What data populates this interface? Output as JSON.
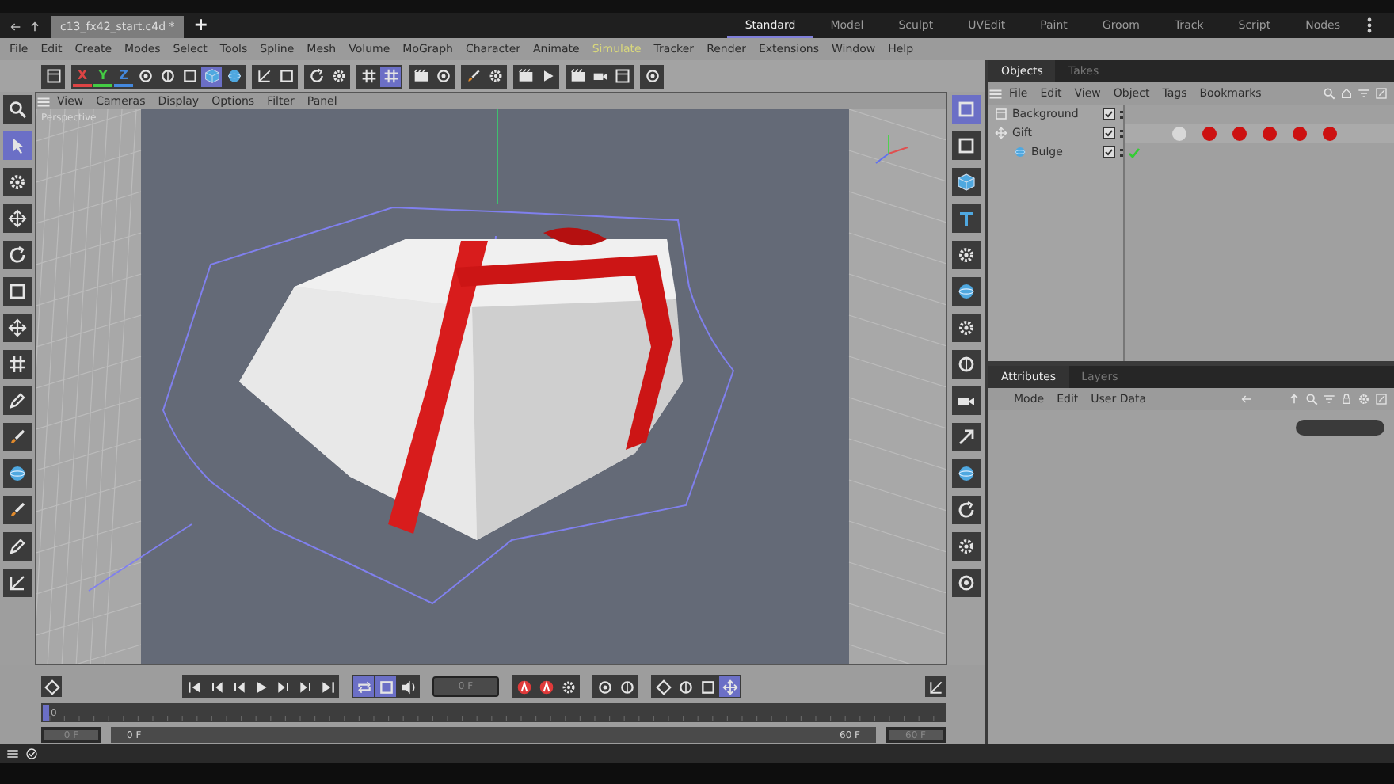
{
  "document_tab": {
    "title": "c13_fx42_start.c4d *"
  },
  "new_tab_button": "+",
  "layouts": [
    {
      "label": "Standard",
      "selected": true
    },
    {
      "label": "Model",
      "selected": false
    },
    {
      "label": "Sculpt",
      "selected": false
    },
    {
      "label": "UVEdit",
      "selected": false
    },
    {
      "label": "Paint",
      "selected": false
    },
    {
      "label": "Groom",
      "selected": false
    },
    {
      "label": "Track",
      "selected": false
    },
    {
      "label": "Script",
      "selected": false
    },
    {
      "label": "Nodes",
      "selected": false
    }
  ],
  "menu": [
    {
      "label": "File",
      "highlighted": false
    },
    {
      "label": "Edit",
      "highlighted": false
    },
    {
      "label": "Create",
      "highlighted": false
    },
    {
      "label": "Modes",
      "highlighted": false
    },
    {
      "label": "Select",
      "highlighted": false
    },
    {
      "label": "Tools",
      "highlighted": false
    },
    {
      "label": "Spline",
      "highlighted": false
    },
    {
      "label": "Mesh",
      "highlighted": false
    },
    {
      "label": "Volume",
      "highlighted": false
    },
    {
      "label": "MoGraph",
      "highlighted": false
    },
    {
      "label": "Character",
      "highlighted": false
    },
    {
      "label": "Animate",
      "highlighted": false
    },
    {
      "label": "Simulate",
      "highlighted": true
    },
    {
      "label": "Tracker",
      "highlighted": false
    },
    {
      "label": "Render",
      "highlighted": false
    },
    {
      "label": "Extensions",
      "highlighted": false
    },
    {
      "label": "Window",
      "highlighted": false
    },
    {
      "label": "Help",
      "highlighted": false
    }
  ],
  "axis_toggles": [
    "X",
    "Y",
    "Z"
  ],
  "toolbar_groups": [
    {
      "tools": [
        {
          "selected": false
        }
      ]
    },
    {
      "tools": [
        {
          "selected": false
        },
        {
          "selected": false
        },
        {
          "selected": false
        },
        {
          "selected": true
        },
        {
          "selected": false
        }
      ]
    },
    {
      "tools": [
        {
          "selected": false
        },
        {
          "selected": false
        }
      ]
    },
    {
      "tools": [
        {
          "selected": false
        },
        {
          "selected": false
        }
      ]
    },
    {
      "tools": [
        {
          "selected": false
        },
        {
          "selected": true
        }
      ]
    },
    {
      "tools": [
        {
          "selected": false
        },
        {
          "selected": false
        }
      ]
    },
    {
      "tools": [
        {
          "selected": false
        },
        {
          "selected": false
        }
      ]
    },
    {
      "tools": [
        {
          "selected": false
        },
        {
          "selected": false
        }
      ]
    },
    {
      "tools": [
        {
          "selected": false
        },
        {
          "selected": false
        },
        {
          "selected": false
        }
      ]
    },
    {
      "tools": [
        {
          "selected": false
        }
      ]
    }
  ],
  "viewport": {
    "menu": [
      "View",
      "Cameras",
      "Display",
      "Options",
      "Filter",
      "Panel"
    ],
    "camera_label": "Perspective"
  },
  "left_tools": [
    {
      "selected": false
    },
    {
      "selected": true
    },
    {
      "selected": false
    },
    {
      "selected": false
    },
    {
      "selected": false
    },
    {
      "selected": false
    },
    {
      "selected": false
    },
    {
      "selected": false
    },
    {
      "selected": false
    },
    {
      "selected": false
    },
    {
      "selected": false
    },
    {
      "selected": false
    },
    {
      "selected": false
    },
    {
      "selected": false
    }
  ],
  "right_tools": [
    {
      "selected": true
    },
    {
      "selected": false
    },
    {
      "selected": false
    },
    {
      "selected": false
    },
    {
      "selected": false
    },
    {
      "selected": false
    },
    {
      "selected": false
    },
    {
      "selected": false
    },
    {
      "selected": false
    },
    {
      "selected": false
    },
    {
      "selected": false
    },
    {
      "selected": false
    },
    {
      "selected": false
    },
    {
      "selected": false
    }
  ],
  "objects_panel": {
    "tabs": [
      {
        "label": "Objects",
        "selected": true
      },
      {
        "label": "Takes",
        "selected": false
      }
    ],
    "menu": [
      "File",
      "Edit",
      "View",
      "Object",
      "Tags",
      "Bookmarks"
    ],
    "tree": [
      {
        "name": "Background",
        "kind": "background",
        "visible": true
      },
      {
        "name": "Gift",
        "kind": "null",
        "visible": true,
        "tags": [
          {
            "color": "#d8d8d8"
          },
          {
            "color": "#cc1111"
          },
          {
            "color": "#cc1111"
          },
          {
            "color": "#cc1111"
          },
          {
            "color": "#cc1111"
          },
          {
            "color": "#cc1111"
          }
        ],
        "children": [
          {
            "name": "Bulge",
            "kind": "deformer",
            "visible": true,
            "enabled": true
          }
        ]
      }
    ]
  },
  "attributes_panel": {
    "tabs": [
      {
        "label": "Attributes",
        "selected": true
      },
      {
        "label": "Layers",
        "selected": false
      }
    ],
    "menu": [
      "Mode",
      "Edit",
      "User Data"
    ]
  },
  "timeline": {
    "transport": [
      {
        "selected": false
      },
      {
        "selected": false
      },
      {
        "selected": false
      },
      {
        "selected": false
      },
      {
        "selected": false
      },
      {
        "selected": false
      },
      {
        "selected": false
      }
    ],
    "playback_toggles": [
      {
        "selected": true
      },
      {
        "selected": true
      },
      {
        "selected": false
      }
    ],
    "current_frame": "0 F",
    "ruler_start": "0",
    "key_tools": [
      {
        "selected": false
      },
      {
        "selected": false
      },
      {
        "selected": false
      },
      {
        "selected": false
      },
      {
        "selected": false
      },
      {
        "selected": false
      },
      {
        "selected": false
      },
      {
        "selected": false
      },
      {
        "selected": true
      }
    ],
    "min_field": "0 F",
    "range": {
      "start": "0 F",
      "end": "60 F",
      "level": 1
    },
    "max_field": "60 F"
  }
}
